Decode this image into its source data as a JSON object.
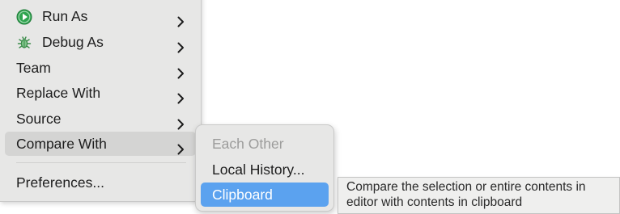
{
  "menu": {
    "items": [
      {
        "label": "Run As",
        "icon": "run-icon"
      },
      {
        "label": "Debug As",
        "icon": "bug-icon"
      },
      {
        "label": "Team"
      },
      {
        "label": "Replace With"
      },
      {
        "label": "Source"
      },
      {
        "label": "Compare With"
      },
      {
        "label": "Preferences..."
      }
    ]
  },
  "submenu": {
    "items": [
      {
        "label": "Each Other",
        "state": "disabled"
      },
      {
        "label": "Local History..."
      },
      {
        "label": "Clipboard",
        "state": "selected"
      }
    ]
  },
  "tooltip": {
    "line1": "Compare the selection or entire contents in",
    "line2": "editor with contents in clipboard"
  },
  "colors": {
    "menu_bg": "#e7e7e6",
    "hover_bg": "#d4d4d3",
    "selection_blue": "#5ba2ef",
    "run_icon_green": "#2fa44f",
    "debug_icon_green": "#3b8c4a"
  }
}
